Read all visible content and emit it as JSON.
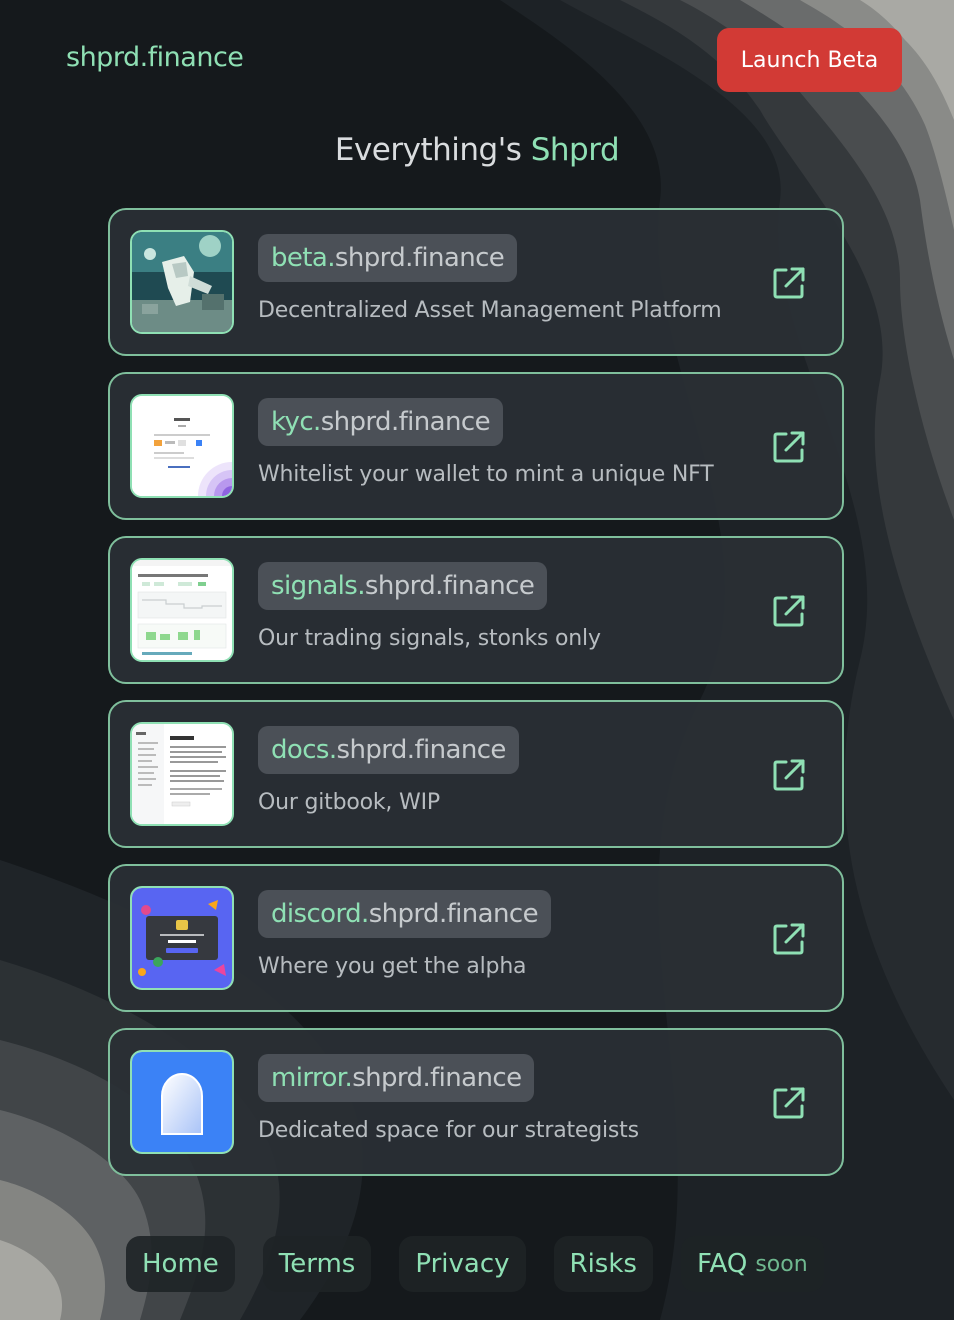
{
  "header": {
    "brand": "shprd.finance",
    "launch_label": "Launch Beta"
  },
  "headline": {
    "prefix": "Everything's",
    "accent": "Shprd"
  },
  "colors": {
    "accent": "#8fe0b4",
    "launch": "#d23a35",
    "background": "#15191c",
    "card": "#2a2f35",
    "pill": "#4b5057"
  },
  "cards": [
    {
      "sub": "beta.",
      "root": "shprd.finance",
      "desc": "Decentralized Asset Management Platform",
      "thumb": "astronaut-art-thumbnail",
      "icon": "external-link-icon"
    },
    {
      "sub": "kyc.",
      "root": "shprd.finance",
      "desc": "Whitelist your wallet to mint a unique NFT",
      "thumb": "kyc-page-thumbnail",
      "icon": "external-link-icon"
    },
    {
      "sub": "signals.",
      "root": "shprd.finance",
      "desc": "Our trading signals, stonks only",
      "thumb": "signals-dashboard-thumbnail",
      "icon": "external-link-icon"
    },
    {
      "sub": "docs.",
      "root": "shprd.finance",
      "desc": "Our gitbook, WIP",
      "thumb": "docs-overview-thumbnail",
      "icon": "external-link-icon"
    },
    {
      "sub": "discord.",
      "root": "shprd.finance",
      "desc": "Where you get the alpha",
      "thumb": "discord-invite-thumbnail",
      "icon": "external-link-icon"
    },
    {
      "sub": "mirror.",
      "root": "shprd.finance",
      "desc": "Dedicated space for our strategists",
      "thumb": "mirror-logo-thumbnail",
      "icon": "external-link-icon"
    }
  ],
  "footer": {
    "links": [
      "Home",
      "Terms",
      "Privacy",
      "Risks",
      "FAQ"
    ],
    "faq_badge": "soon"
  }
}
